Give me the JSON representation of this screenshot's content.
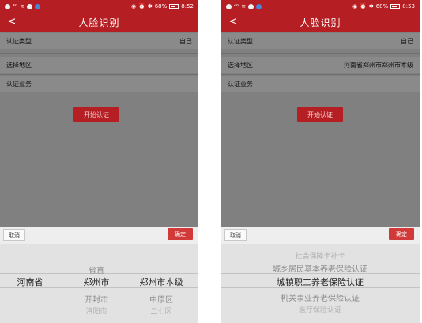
{
  "status_bar": {
    "left": {
      "signal": "⁴ᴳ",
      "wifi": "≋"
    },
    "right": {
      "bluetooth": "✱",
      "alarm": "⏰",
      "battery_percent": "68%"
    },
    "times": [
      "8:52",
      "8:53"
    ]
  },
  "icons": {
    "back": "back-arrow-icon",
    "eye": "eye-icon",
    "bluetooth": "bluetooth-icon",
    "alarm": "alarm-icon",
    "battery": "battery-icon",
    "signal": "signal-icon",
    "wifi": "wifi-icon"
  },
  "colors": {
    "header_red": "#b51e22",
    "confirm_red": "#d23a3a",
    "overlay_gray": "#808080"
  },
  "screens": [
    {
      "title": "人脸识别",
      "back_glyph": "<",
      "rows": {
        "type_label": "认证类型",
        "type_value": "自己",
        "region_label": "选择地区",
        "region_value": "",
        "business_label": "认证业务",
        "business_value": ""
      },
      "start_label": "开始认证",
      "picker": {
        "cancel": "取消",
        "confirm": "确定",
        "col1": {
          "above": "",
          "selected": "河南省",
          "below": ""
        },
        "col2": {
          "above": "省直",
          "selected": "郑州市",
          "below": "开封市",
          "below2": "洛阳市"
        },
        "col3": {
          "above": "",
          "selected": "郑州市本级",
          "below": "中原区",
          "below2": "二七区"
        }
      }
    },
    {
      "title": "人脸识别",
      "back_glyph": "<",
      "rows": {
        "type_label": "认证类型",
        "type_value": "自己",
        "region_label": "选择地区",
        "region_value": "河南省郑州市郑州市本级",
        "business_label": "认证业务",
        "business_value": ""
      },
      "start_label": "开始认证",
      "picker": {
        "cancel": "取消",
        "confirm": "确定",
        "list_above2": "社会保障卡补卡",
        "list_above": "城乡居民基本养老保险认证",
        "list_selected": "城镇职工养老保险认证",
        "list_below": "机关事业养老保险认证",
        "list_below2": "医疗保险认证"
      }
    }
  ]
}
